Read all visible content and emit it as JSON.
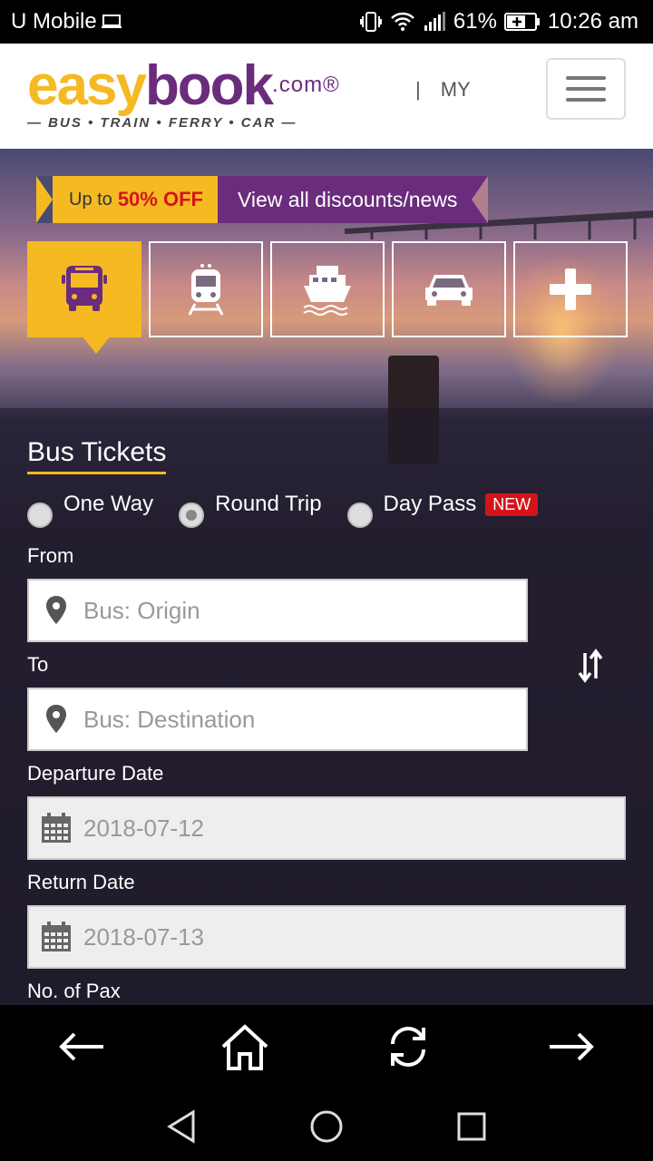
{
  "status_bar": {
    "carrier": "U Mobile",
    "battery": "61%",
    "time": "10:26 am"
  },
  "header": {
    "logo_easy": "easy",
    "logo_book": "book",
    "logo_dotcom": ".com®",
    "logo_tagline": "— BUS • TRAIN • FERRY • CAR —",
    "separator": "|",
    "country": "MY"
  },
  "promo": {
    "prefix": "Up to",
    "highlight": "50% OFF",
    "link": "View all discounts/news"
  },
  "modes": [
    {
      "name": "bus",
      "icon": "bus-icon",
      "active": true
    },
    {
      "name": "train",
      "icon": "train-icon",
      "active": false
    },
    {
      "name": "ferry",
      "icon": "ferry-icon",
      "active": false
    },
    {
      "name": "car",
      "icon": "car-icon",
      "active": false
    },
    {
      "name": "more",
      "icon": "plus-icon",
      "active": false
    }
  ],
  "form": {
    "title": "Bus Tickets",
    "trip_types": [
      {
        "label": "One Way",
        "checked": false
      },
      {
        "label": "Round Trip",
        "checked": true
      },
      {
        "label": "Day Pass",
        "checked": false
      }
    ],
    "new_badge": "NEW",
    "from_label": "From",
    "from_placeholder": "Bus: Origin",
    "to_label": "To",
    "to_placeholder": "Bus: Destination",
    "departure_label": "Departure Date",
    "departure_value": "2018-07-12",
    "return_label": "Return Date",
    "return_value": "2018-07-13",
    "pax_label": "No. of Pax"
  },
  "colors": {
    "brand_yellow": "#f5b922",
    "brand_purple": "#6b2c7d",
    "accent_red": "#d4141b"
  }
}
